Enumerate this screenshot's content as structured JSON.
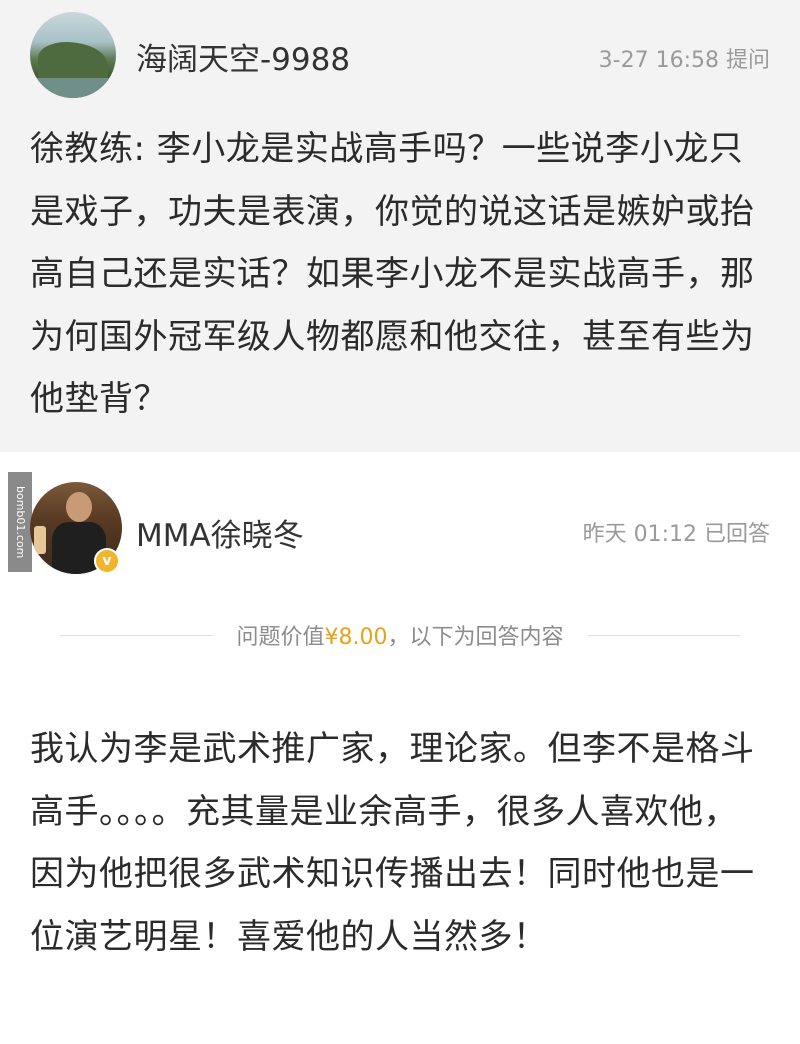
{
  "question": {
    "author": "海阔天空-9988",
    "meta": "3-27 16:58 提问",
    "text": "徐教练: 李小龙是实战高手吗？一些说李小龙只是戏子，功夫是表演，你觉的说这话是嫉妒或抬高自己还是实话？如果李小龙不是实战高手，那为何国外冠军级人物都愿和他交往，甚至有些为他垫背？"
  },
  "watermark": "bomb01.com",
  "answer": {
    "author": "MMA徐晓冬",
    "meta": "昨天 01:12 已回答",
    "verified_mark": "v",
    "divider_prefix": "问题价值",
    "price": "¥8.00",
    "divider_suffix": "，以下为回答内容",
    "text": "我认为李是武术推广家，理论家。但李不是格斗高手。。。。充其量是业余高手，很多人喜欢他，因为他把很多武术知识传播出去！同时他也是一位演艺明星！喜爱他的人当然多！"
  }
}
